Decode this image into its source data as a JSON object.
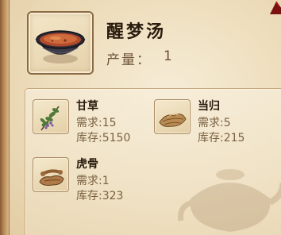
{
  "recipe": {
    "name": "醒梦汤",
    "yield_label": "产量：",
    "yield_value": "1",
    "icon": "soup-bowl-icon"
  },
  "materials": [
    {
      "name": "甘草",
      "required": "需求:15",
      "stock": "库存:5150",
      "icon": "licorice-herb-icon"
    },
    {
      "name": "当归",
      "required": "需求:5",
      "stock": "库存:215",
      "icon": "angelica-root-icon"
    },
    {
      "name": "虎骨",
      "required": "需求:1",
      "stock": "库存:323",
      "icon": "tiger-bone-icon"
    }
  ],
  "colors": {
    "parchment": "#eddcba",
    "frame": "#8b6b45",
    "title_text": "#2a1c0e",
    "value_text": "#7a6141",
    "soup": "#c0522e"
  }
}
